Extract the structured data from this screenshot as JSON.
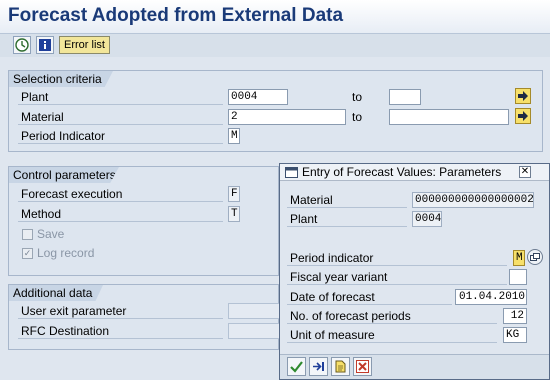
{
  "header": {
    "title": "Forecast Adopted from External Data"
  },
  "toolbar": {
    "execute_icon": "execute-icon",
    "info_icon": "info-icon",
    "error_list_label": "Error list"
  },
  "selection": {
    "heading": "Selection criteria",
    "plant_label": "Plant",
    "plant_value": "0004",
    "plant_to_label": "to",
    "plant_to_value": "",
    "material_label": "Material",
    "material_value": "2",
    "material_to_label": "to",
    "material_to_value": "",
    "period_label": "Period Indicator",
    "period_value": "M"
  },
  "control": {
    "heading": "Control parameters",
    "forecast_label": "Forecast execution",
    "forecast_value": "F",
    "method_label": "Method",
    "method_value": "T",
    "save_label": "Save",
    "save_checked": false,
    "log_label": "Log record",
    "log_checked": true
  },
  "additional": {
    "heading": "Additional data",
    "user_exit_label": "User exit parameter",
    "user_exit_value": "",
    "rfc_label": "RFC Destination",
    "rfc_value": ""
  },
  "popup": {
    "title": "Entry of Forecast Values: Parameters",
    "material_label": "Material",
    "material_value": "000000000000000002",
    "plant_label": "Plant",
    "plant_value": "0004",
    "period_label": "Period indicator",
    "period_value": "M",
    "fiscal_label": "Fiscal year variant",
    "fiscal_value": "",
    "date_label": "Date of forecast",
    "date_value": "01.04.2010",
    "periods_label": "No. of forecast periods",
    "periods_value": "12",
    "uom_label": "Unit of measure",
    "uom_value": "KG"
  },
  "colors": {
    "title": "#1a3a78",
    "background": "#dfe6ef",
    "selection_button": "#f7e06a",
    "error_list_button": "#f2e69a"
  }
}
